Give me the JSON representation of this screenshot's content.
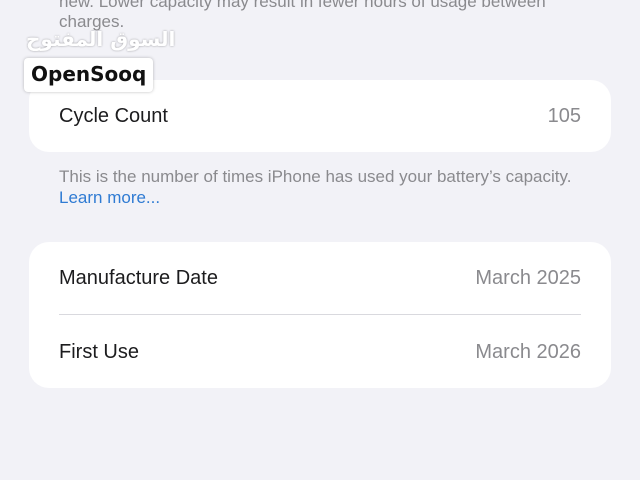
{
  "top_note": {
    "text": "new. Lower capacity may result in fewer hours of usage between charges."
  },
  "watermark": {
    "arabic_text": "السوق المفتوح",
    "logo_text": "OpenSooq"
  },
  "cycle": {
    "label": "Cycle Count",
    "value": "105",
    "footnote_text": "This is the number of times iPhone has used your battery’s capacity.",
    "learn_more": "Learn more..."
  },
  "dates": {
    "manufacture_label": "Manufacture Date",
    "manufacture_value": "March 2025",
    "first_use_label": "First Use",
    "first_use_value": "March 2026"
  },
  "colors": {
    "background": "#f2f2f7",
    "card": "#ffffff",
    "secondary_text": "#8a8a8e",
    "link": "#2f7bd3"
  }
}
